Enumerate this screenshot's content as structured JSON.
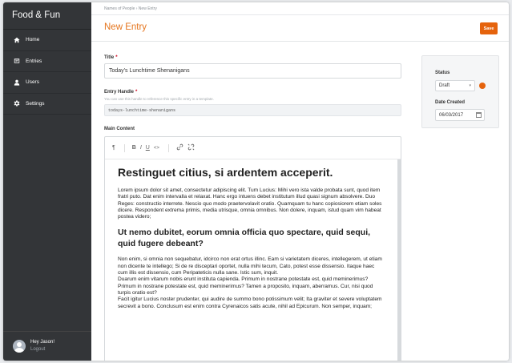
{
  "app": {
    "title": "Food & Fun"
  },
  "sidebar": {
    "items": [
      {
        "label": "Home",
        "icon": "home-icon"
      },
      {
        "label": "Entries",
        "icon": "entries-icon"
      },
      {
        "label": "Users",
        "icon": "user-icon"
      },
      {
        "label": "Settings",
        "icon": "gear-icon"
      }
    ]
  },
  "user": {
    "greeting": "Hey Jason!",
    "logout": "Logout"
  },
  "breadcrumb": "Names of People › New Entry",
  "header": {
    "title": "New Entry",
    "save_label": "Save"
  },
  "form": {
    "title_label": "Title",
    "title_value": "Today's Lunchtime Shenanigans",
    "handle_label": "Entry Handle",
    "handle_hint": "You can use this handle to reference this specific entry in a template.",
    "handle_value": "todays-lunchtime-shenanigans",
    "content_label": "Main Content"
  },
  "toolbar": {
    "paragraph": "¶",
    "bold": "B",
    "italic": "I",
    "underline": "U",
    "code": "<>"
  },
  "content": {
    "heading1": "Restinguet citius, si ardentem acceperit.",
    "paragraph1": "Lorem ipsum dolor sit amet, consectetur adipiscing elit. Tum Lucius: Mihi vero ista valde probata sunt, quod item fratri puto. Dat enim intervalla et relaxat. Hanc ergo intuens debet institutum illud quasi signum absolvere. Duo Reges: constructio interrete. Nescio quo modo praetervolavit oratio. Quamquam tu hanc copiosiorem etiam soles dicere. Respondent extrema primis, media utrisque, omnia omnibus. Non dolere, inquam, istud quam vim habeat postea videro;",
    "heading2": "Ut nemo dubitet, eorum omnia officia quo spectare, quid sequi, quid fugere debeant?",
    "paragraph2_lines": [
      "Non enim, si omnia non sequebatur, idcirco non erat ortus illinc. Eam si varietatem diceres, intellegerem, ut etiam non dicente te intellego; Si de re disceptari oportet, nulla mihi tecum, Cato, potest esse dissensio. Itaque haec cum illis est dissensio, cum Peripateticis nulla sane. Istic sum, inquit.",
      "Duarum enim vitarum nobis erunt instituta capienda. Primum in nostrane potestate est, quid meminerimus? Primum in nostrane potestate est, quid meminerimus? Tamen a proposito, inquam, aberramus. Cur, nisi quod turpis oratio est?",
      "Facit igitur Lucius noster prudenter, qui audire de summo bono potissimum velit; Ita graviter et severe voluptatem secrevit a bono. Conclusum est enim contra Cyrenaicos satis acute, nihil ad Epicurum. Non semper, inquam;"
    ]
  },
  "panel": {
    "status_label": "Status",
    "status_value": "Draft",
    "status_color": "#e5630d",
    "date_label": "Date Created",
    "date_value": "06/03/2017"
  },
  "colors": {
    "accent": "#e5630d",
    "title": "#e5751d",
    "sidebar": "#333538"
  }
}
